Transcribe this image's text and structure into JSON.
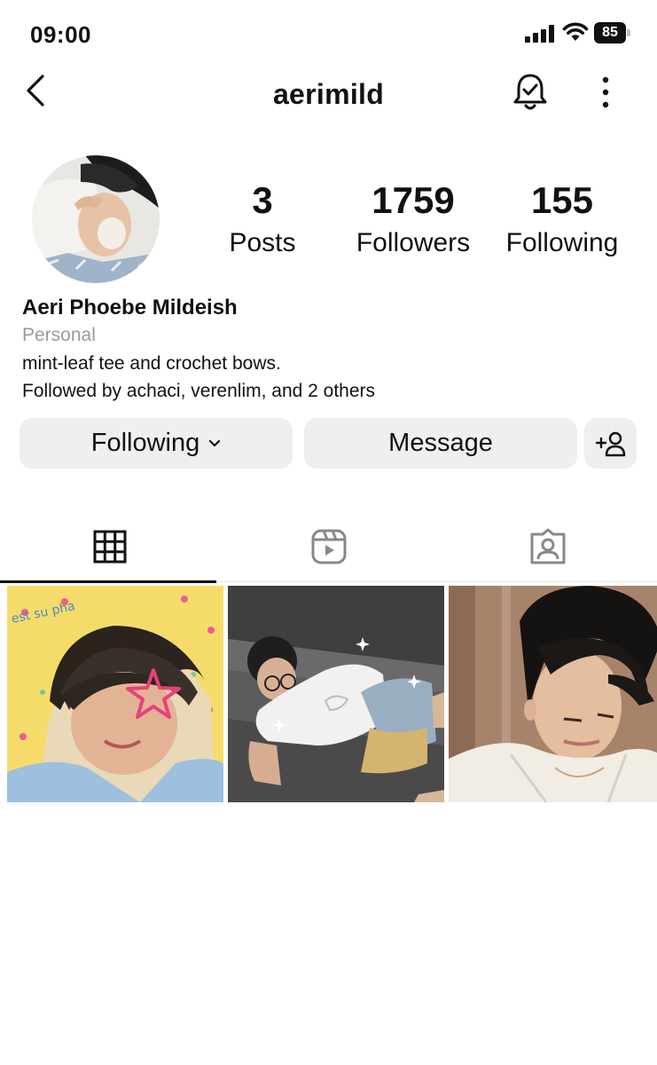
{
  "status_bar": {
    "time": "09:00",
    "battery": "85"
  },
  "nav": {
    "title": "aerimild"
  },
  "profile": {
    "stats": [
      {
        "value": "3",
        "label": "Posts"
      },
      {
        "value": "1759",
        "label": "Followers"
      },
      {
        "value": "155",
        "label": "Following"
      }
    ],
    "name": "Aeri Phoebe Mildeish",
    "category": "Personal",
    "bio": "mint-leaf tee and crochet bows.",
    "followed_by": "Followed by achaci, verenlim, and 2 others"
  },
  "actions": {
    "following_label": "Following",
    "message_label": "Message"
  },
  "tabs": [
    {
      "icon": "grid-icon",
      "active": true
    },
    {
      "icon": "reels-icon",
      "active": false
    },
    {
      "icon": "tagged-icon",
      "active": false
    }
  ],
  "posts": [
    {
      "overlay_text": "est su pha"
    },
    {
      "overlay_text": ""
    },
    {
      "overlay_text": ""
    }
  ]
}
